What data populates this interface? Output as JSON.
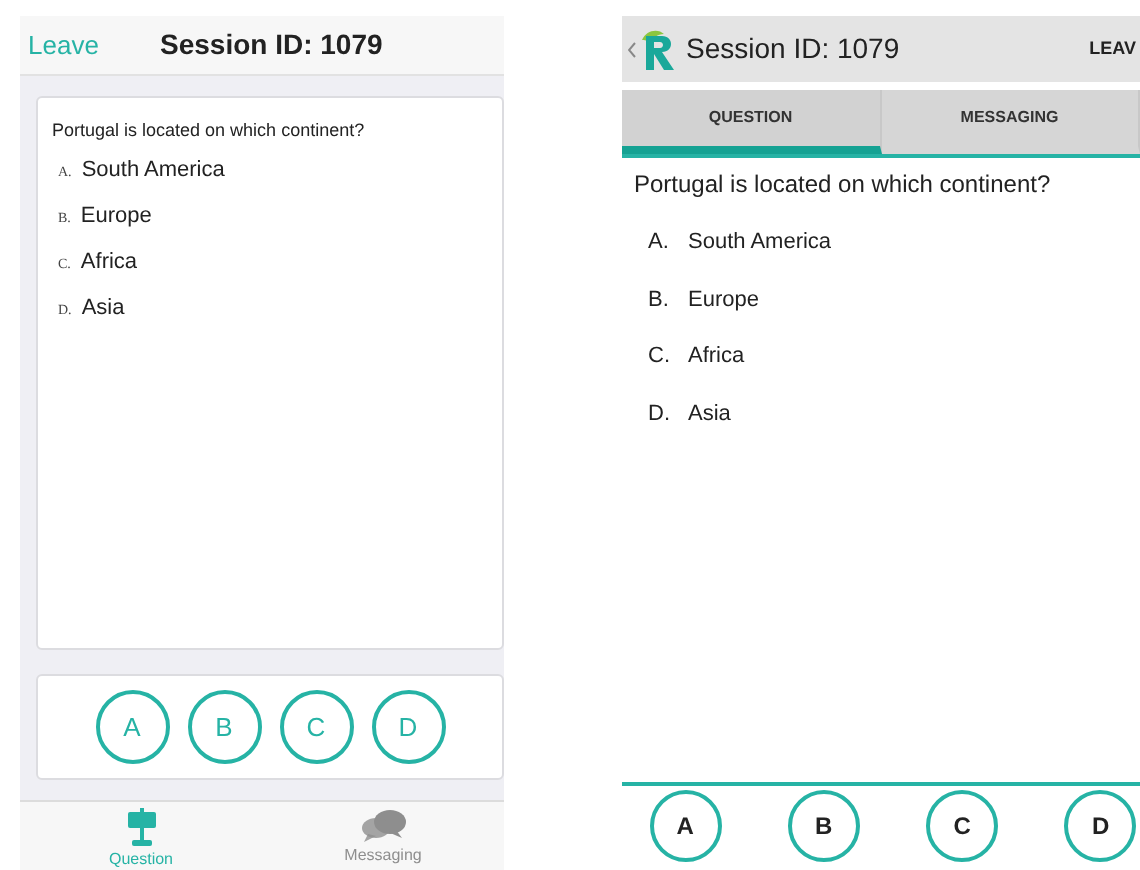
{
  "ios_screen": {
    "leave_link": "Leave",
    "title": "Session ID: 1079",
    "question": "Portugal is located on which continent?",
    "options": [
      {
        "letter": "A.",
        "text": "South America"
      },
      {
        "letter": "B.",
        "text": "Europe"
      },
      {
        "letter": "C.",
        "text": "Africa"
      },
      {
        "letter": "D.",
        "text": "Asia"
      }
    ],
    "answer_buttons": [
      "A",
      "B",
      "C",
      "D"
    ],
    "tabs": [
      {
        "label": "Question",
        "kind": "question",
        "selected": true
      },
      {
        "label": "Messaging",
        "kind": "messaging",
        "selected": false
      }
    ]
  },
  "android_screen": {
    "title": "Session ID: 1079",
    "leave_button": "LEAV",
    "tabs": [
      {
        "label": "QUESTION",
        "selected": true
      },
      {
        "label": "MESSAGING",
        "selected": false
      }
    ],
    "question": "Portugal is located on which continent?",
    "options": [
      {
        "letter": "A.",
        "text": "South America"
      },
      {
        "letter": "B.",
        "text": "Europe"
      },
      {
        "letter": "C.",
        "text": "Africa"
      },
      {
        "letter": "D.",
        "text": "Asia"
      }
    ],
    "answer_buttons": [
      "A",
      "B",
      "C",
      "D"
    ]
  }
}
